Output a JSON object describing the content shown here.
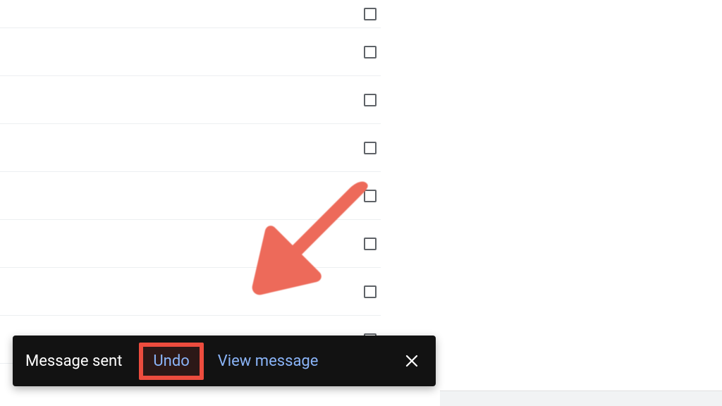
{
  "toast": {
    "status_label": "Message sent",
    "undo_label": "Undo",
    "view_label": "View message"
  },
  "annotation": {
    "arrow_color": "#ed6a5a",
    "highlight_color": "#ed4c3e"
  },
  "mail_rows": 8
}
